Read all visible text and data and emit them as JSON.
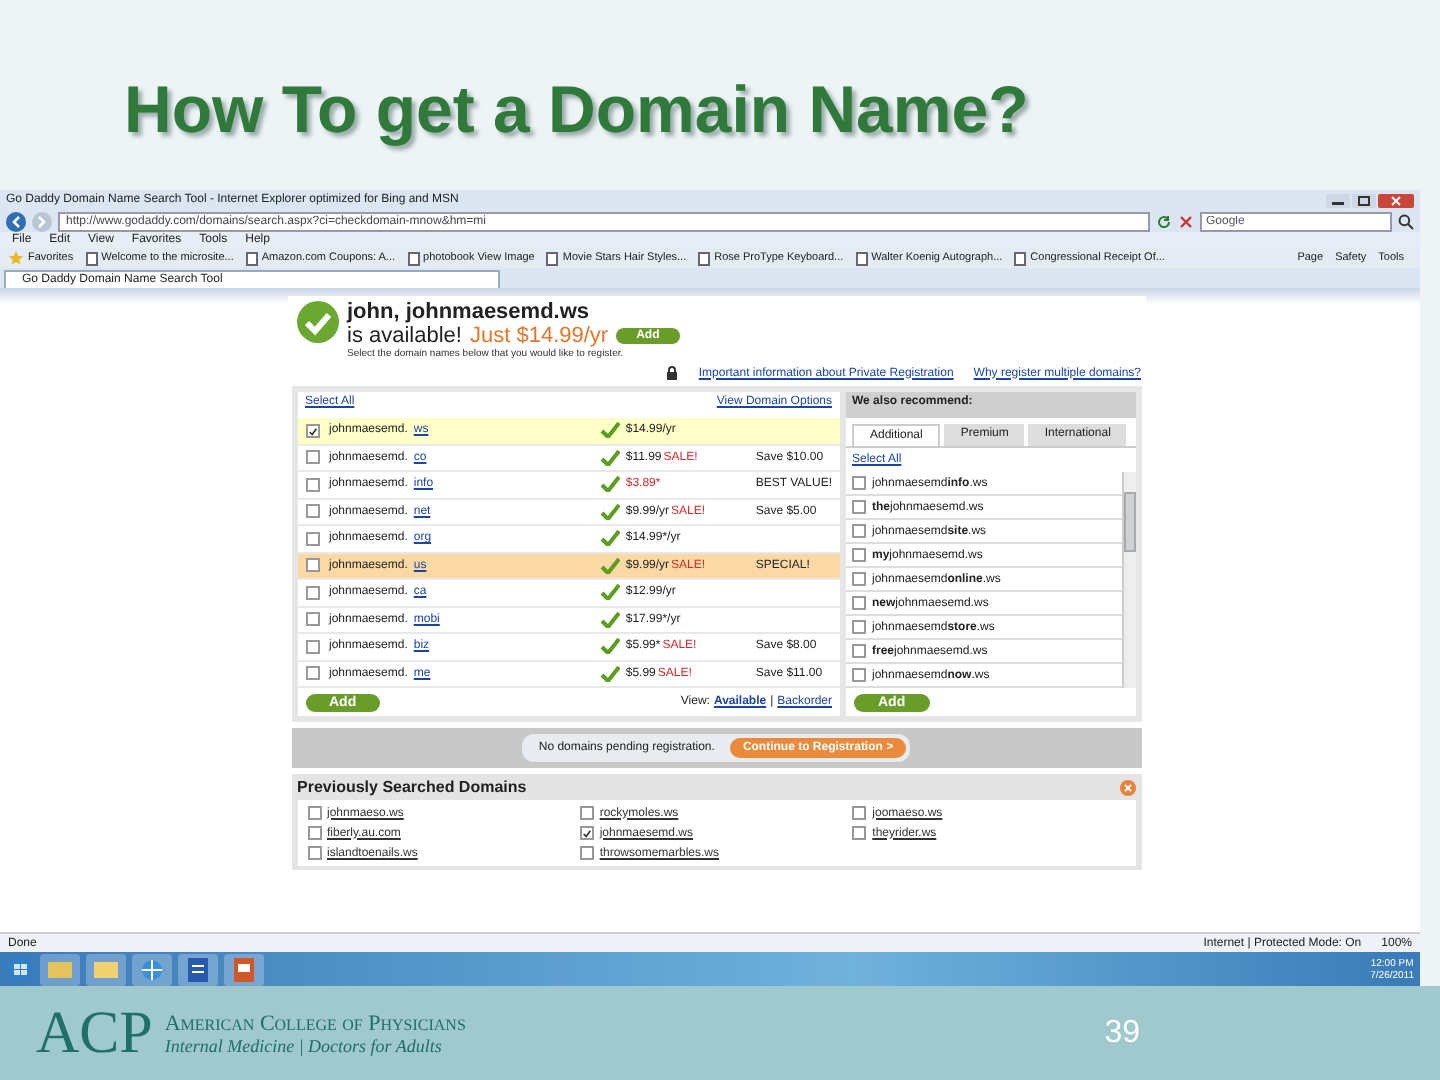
{
  "slide": {
    "title": "How To get a Domain Name?",
    "page_number": "39",
    "logo": {
      "mark": "ACP",
      "name": "American College of Physicians",
      "tagline": "Internal Medicine | Doctors for Adults"
    }
  },
  "browser": {
    "window_title": "Go Daddy Domain Name Search Tool - Internet Explorer optimized for Bing and MSN",
    "address": "http://www.godaddy.com/domains/search.aspx?ci=checkdomain-mnow&hm=mi",
    "search_placeholder": "Google",
    "menu": [
      "File",
      "Edit",
      "View",
      "Favorites",
      "Tools",
      "Help"
    ],
    "favorites_label": "Favorites",
    "favorites": [
      "Welcome to the microsite...",
      "Amazon.com Coupons: A...",
      "photobook View Image",
      "Movie Stars Hair Styles...",
      "Rose ProType Keyboard...",
      "Walter Koenig Autograph...",
      "Congressional Receipt Of..."
    ],
    "commands": [
      "Page",
      "Safety",
      "Tools"
    ],
    "tab": "Go Daddy Domain Name Search Tool"
  },
  "result": {
    "headline": "john, johnmaesemd.ws",
    "available": "is available!",
    "price": "Just $14.99/yr",
    "add": "Add",
    "instructions": "Select the domain names below that you would like to register.",
    "links": [
      "Important information about Private Registration",
      "Why register multiple domains?"
    ]
  },
  "domains": {
    "select_all": "Select All",
    "options": "View Domain Options",
    "rows": [
      {
        "name": "johnmaesemd.",
        "tld": "ws",
        "checked": true,
        "color": "#ffffc8",
        "price": "$14.99/yr"
      },
      {
        "name": "johnmaesemd.",
        "tld": "co",
        "checked": false,
        "price": "$11.99",
        "sale": "SALE!",
        "note": "Save $10.00"
      },
      {
        "name": "johnmaesemd.",
        "tld": "info",
        "checked": false,
        "sale": "$3.89*",
        "note": "BEST VALUE!"
      },
      {
        "name": "johnmaesemd.",
        "tld": "net",
        "checked": false,
        "price": "$9.99/yr",
        "sale": "SALE!",
        "note": "Save $5.00"
      },
      {
        "name": "johnmaesemd.",
        "tld": "org",
        "checked": false,
        "price": "$14.99*/yr"
      },
      {
        "name": "johnmaesemd.",
        "tld": "us",
        "checked": false,
        "color": "#fcd8a4",
        "price": "$9.99/yr",
        "sale": "SALE!",
        "note": "SPECIAL!"
      },
      {
        "name": "johnmaesemd.",
        "tld": "ca",
        "checked": false,
        "price": "$12.99/yr"
      },
      {
        "name": "johnmaesemd.",
        "tld": "mobi",
        "checked": false,
        "price": "$17.99*/yr"
      },
      {
        "name": "johnmaesemd.",
        "tld": "biz",
        "checked": false,
        "price": "$5.99*",
        "sale": "SALE!",
        "note": "Save $8.00"
      },
      {
        "name": "johnmaesemd.",
        "tld": "me",
        "checked": false,
        "price": "$5.99",
        "sale": "SALE!",
        "note": "Save $11.00"
      }
    ],
    "add": "Add",
    "view_label": "View:",
    "separator": "|",
    "views": [
      {
        "label": "Available",
        "selected": true
      },
      {
        "label": "Backorder",
        "selected": false
      }
    ]
  },
  "recommend": {
    "title": "We also recommend:",
    "tabs": [
      {
        "label": "Additional",
        "selected": true
      },
      {
        "label": "Premium",
        "selected": false
      },
      {
        "label": "International",
        "selected": false
      }
    ],
    "select_all": "Select All",
    "items": [
      {
        "label": "johnmaesemd**info**.ws",
        "checked": false
      },
      {
        "label": "**the**johnmaesemd.ws",
        "checked": false
      },
      {
        "label": "johnmaesemd**site**.ws",
        "checked": false
      },
      {
        "label": "**my**johnmaesemd.ws",
        "checked": false
      },
      {
        "label": "johnmaesemd**online**.ws",
        "checked": false
      },
      {
        "label": "**new**johnmaesemd.ws",
        "checked": false
      },
      {
        "label": "johnmaesemd**store**.ws",
        "checked": false
      },
      {
        "label": "**free**johnmaesemd.ws",
        "checked": false
      },
      {
        "label": "johnmaesemd**now**.ws",
        "checked": false
      }
    ],
    "add": "Add"
  },
  "pending": {
    "message": "No domains pending registration.",
    "button": "Continue to Registration >"
  },
  "previous": {
    "title": "Previously Searched Domains",
    "items": [
      {
        "label": "johnmaeso.ws",
        "checked": false
      },
      {
        "label": "rockymoles.ws",
        "checked": false
      },
      {
        "label": "joomaeso.ws",
        "checked": false
      },
      {
        "label": "fiberly.au.com",
        "checked": false
      },
      {
        "label": "johnmaesemd.ws",
        "checked": true
      },
      {
        "label": "theyrider.ws",
        "checked": false
      },
      {
        "label": "islandtoenails.ws",
        "checked": false
      },
      {
        "label": "throwsomemarbles.ws",
        "checked": false
      }
    ]
  },
  "status_bar": {
    "left": "Done",
    "zone": "Internet | Protected Mode: On",
    "zoom": "100%"
  },
  "taskbar": {
    "time": "12:00 PM",
    "date": "7/26/2011"
  }
}
